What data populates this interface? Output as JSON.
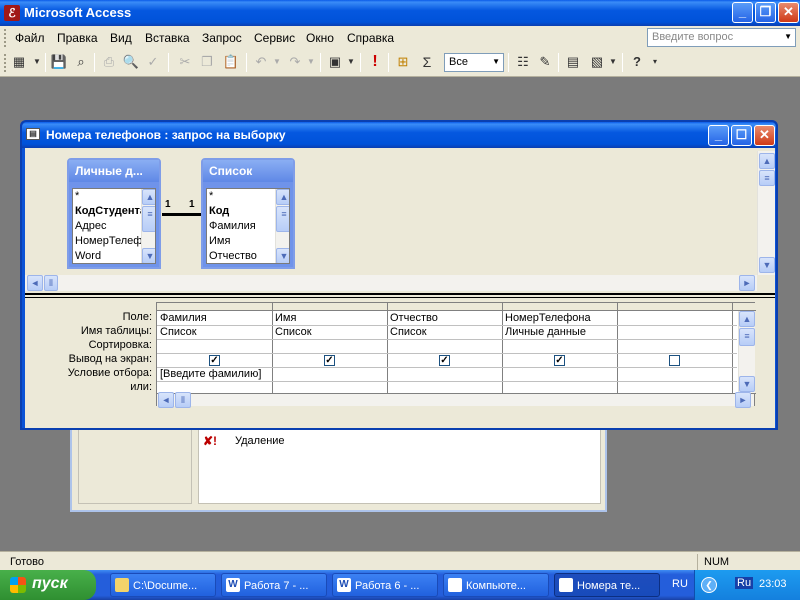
{
  "app": {
    "title": "Microsoft Access",
    "help_placeholder": "Введите вопрос"
  },
  "menu": [
    "Файл",
    "Правка",
    "Вид",
    "Вставка",
    "Запрос",
    "Сервис",
    "Окно",
    "Справка"
  ],
  "toolbar": {
    "top_values": "Все",
    "sigma": "Σ",
    "exclaim": "!",
    "help": "?"
  },
  "query_window": {
    "title": "Номера телефонов : запрос на выборку",
    "tables": [
      {
        "name": "Личные д...",
        "fields": [
          "*",
          "КодСтудента",
          "Адрес",
          "НомерТелефона",
          "Word"
        ]
      },
      {
        "name": "Список",
        "fields": [
          "*",
          "Код",
          "Фамилия",
          "Имя",
          "Отчество"
        ]
      }
    ],
    "relation": {
      "left": "1",
      "right": "1"
    },
    "row_labels": [
      "Поле:",
      "Имя таблицы:",
      "Сортировка:",
      "Вывод на экран:",
      "Условие отбора:",
      "или:"
    ],
    "columns": [
      {
        "field": "Фамилия",
        "table": "Список",
        "show": true,
        "criteria": "[Введите фамилию]"
      },
      {
        "field": "Имя",
        "table": "Список",
        "show": true,
        "criteria": ""
      },
      {
        "field": "Отчество",
        "table": "Список",
        "show": true,
        "criteria": ""
      },
      {
        "field": "НомерТелефона",
        "table": "Личные данные",
        "show": true,
        "criteria": ""
      },
      {
        "field": "",
        "table": "",
        "show": false,
        "criteria": ""
      }
    ]
  },
  "background_window": {
    "item_label": "Удаление",
    "item_icon": "✘!"
  },
  "status": {
    "left": "Готово",
    "num": "NUM"
  },
  "taskbar": {
    "start": "пуск",
    "buttons": [
      "C:\\Docume...",
      "Работа 7 - ...",
      "Работа 6 - ...",
      "Компьюте...",
      "Номера те..."
    ],
    "lang": "RU",
    "kbd": "Ru",
    "clock": "23:03"
  }
}
